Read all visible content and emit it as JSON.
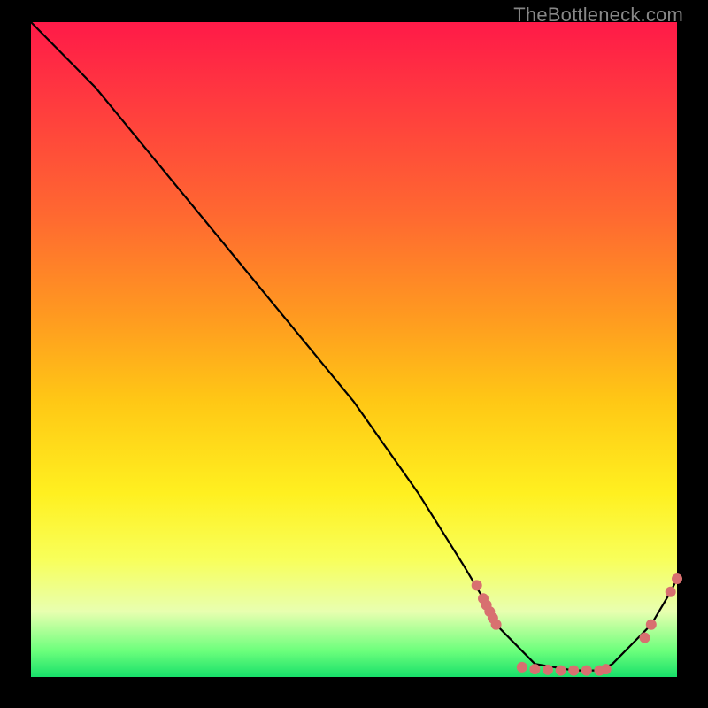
{
  "brand": "TheBottleneck.com",
  "chart_data": {
    "type": "line",
    "title": "",
    "xlabel": "",
    "ylabel": "",
    "xlim": [
      0,
      100
    ],
    "ylim": [
      0,
      100
    ],
    "x": [
      0,
      6,
      10,
      20,
      30,
      40,
      50,
      60,
      67,
      70,
      72,
      78,
      84,
      88,
      90,
      93,
      96,
      99,
      100
    ],
    "values": [
      100,
      94,
      90,
      78,
      66,
      54,
      42,
      28,
      17,
      12,
      8,
      2,
      1,
      1,
      2,
      5,
      8,
      13,
      15
    ],
    "series": [
      {
        "name": "curve",
        "x": [
          0,
          6,
          10,
          20,
          30,
          40,
          50,
          60,
          67,
          70,
          72,
          78,
          84,
          88,
          90,
          93,
          96,
          99,
          100
        ],
        "values": [
          100,
          94,
          90,
          78,
          66,
          54,
          42,
          28,
          17,
          12,
          8,
          2,
          1,
          1,
          2,
          5,
          8,
          13,
          15
        ]
      }
    ],
    "markers": [
      {
        "x": 69,
        "y": 14
      },
      {
        "x": 70,
        "y": 12
      },
      {
        "x": 70.5,
        "y": 11
      },
      {
        "x": 71,
        "y": 10
      },
      {
        "x": 71.5,
        "y": 9
      },
      {
        "x": 72,
        "y": 8
      },
      {
        "x": 76,
        "y": 1.5
      },
      {
        "x": 78,
        "y": 1.2
      },
      {
        "x": 80,
        "y": 1.1
      },
      {
        "x": 82,
        "y": 1.0
      },
      {
        "x": 84,
        "y": 1.0
      },
      {
        "x": 86,
        "y": 1.0
      },
      {
        "x": 88,
        "y": 1.0
      },
      {
        "x": 89,
        "y": 1.2
      },
      {
        "x": 95,
        "y": 6
      },
      {
        "x": 96,
        "y": 8
      },
      {
        "x": 99,
        "y": 13
      },
      {
        "x": 100,
        "y": 15
      }
    ],
    "colors": {
      "marker": "#d87070",
      "line": "#000000"
    }
  }
}
